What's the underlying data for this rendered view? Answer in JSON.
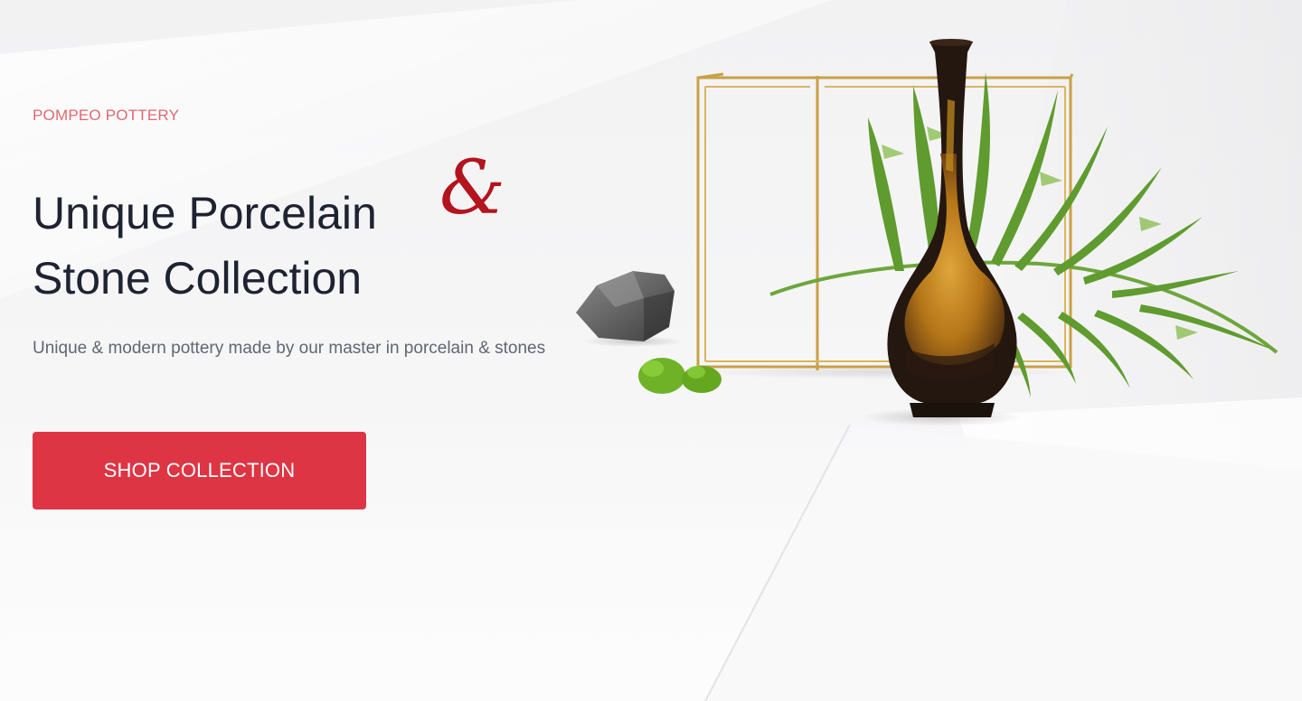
{
  "hero": {
    "eyebrow": "POMPEO POTTERY",
    "headline_line_1": "Unique Porcelain",
    "headline_ampersand": "&",
    "headline_line_2": "Stone Collection",
    "subtitle": "Unique & modern pottery made by our master in porcelain & stones",
    "cta_label": "SHOP COLLECTION"
  },
  "colors": {
    "eyebrow": "#e0686f",
    "ampersand": "#b3141d",
    "headline": "#1e2231",
    "body_text": "#616673",
    "cta_background": "#de3544",
    "cta_text": "#ffffff",
    "background": "#f3f3f4",
    "frame_gold": "#c9a046",
    "fern_green": "#5f9b2e",
    "vase_dark": "#2a1a12",
    "vase_gold": "#c8901f",
    "stone_gray": "#6e6e6e",
    "moss_green": "#6fb227"
  },
  "illustration": {
    "items": [
      "gold-frame-cube",
      "fern-leaf",
      "black-gold-vase",
      "gray-stone",
      "green-moss"
    ]
  }
}
